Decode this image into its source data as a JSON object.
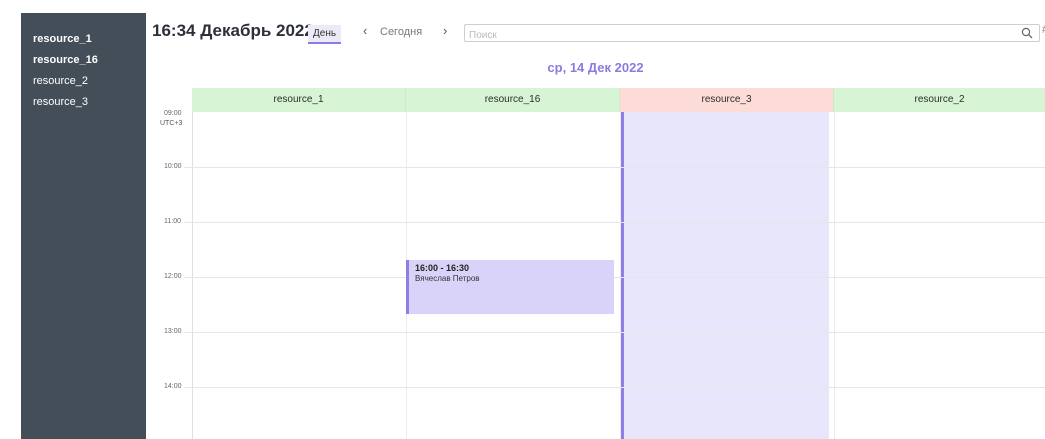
{
  "sidebar": {
    "items": [
      {
        "label": "resource_1"
      },
      {
        "label": "resource_16"
      },
      {
        "label": "resource_2"
      },
      {
        "label": "resource_3"
      }
    ]
  },
  "header": {
    "title": "16:34 Декабрь 2022",
    "view_label": "День",
    "prev_icon": "‹",
    "today_label": "Сегодня",
    "next_icon": "›",
    "search_placeholder": "Поиск",
    "extra_icon": "#"
  },
  "date_header": "ср, 14 Дек 2022",
  "timezone": "UTC+3",
  "resources": [
    {
      "label": "resource_1",
      "color": "#d7f4d4"
    },
    {
      "label": "resource_16",
      "color": "#d7f4d4"
    },
    {
      "label": "resource_3",
      "color": "#fddcd7"
    },
    {
      "label": "resource_2",
      "color": "#d7f4d4"
    }
  ],
  "hours": [
    "09:00",
    "10:00",
    "11:00",
    "12:00",
    "13:00",
    "14:00"
  ],
  "event": {
    "time": "16:00 - 16:30",
    "person": "Вячеслав Петров"
  },
  "colors": {
    "sidebar": "#434e59",
    "accent": "#8b7be0",
    "event_bg": "#d9d3f9",
    "busy_bg": "#e8e6fb"
  }
}
